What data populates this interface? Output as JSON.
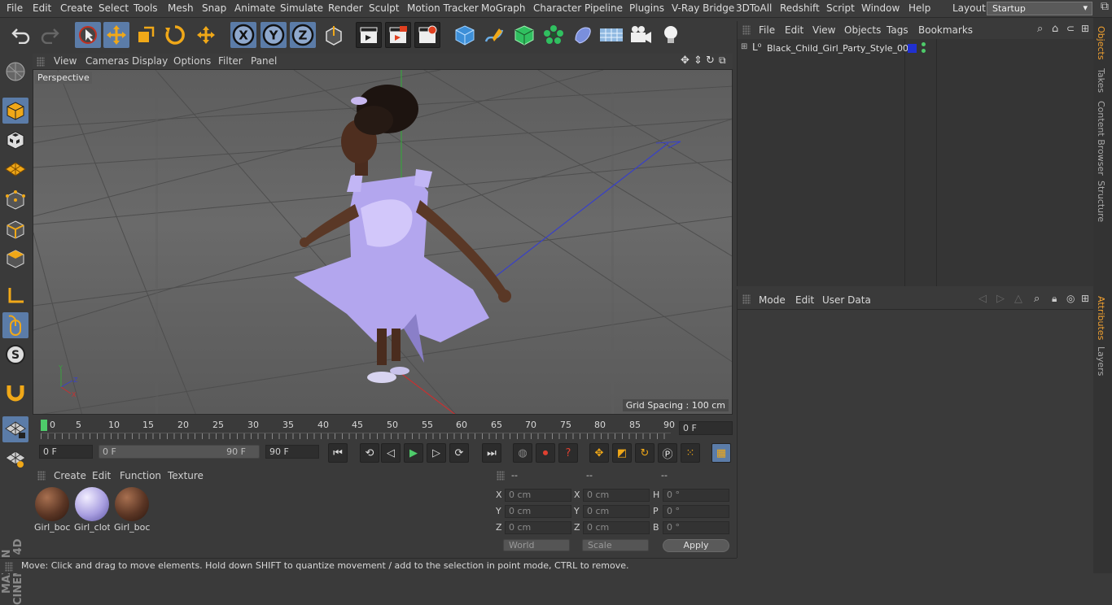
{
  "menubar": {
    "items": [
      "File",
      "Edit",
      "Create",
      "Select",
      "Tools",
      "Mesh",
      "Snap",
      "Animate",
      "Simulate",
      "Render",
      "Sculpt",
      "Motion Tracker",
      "MoGraph",
      "Character",
      "Pipeline",
      "Plugins",
      "V-Ray Bridge",
      "3DToAll",
      "Redshift",
      "Script",
      "Window",
      "Help"
    ],
    "layout_label": "Layout:",
    "layout_value": "Startup"
  },
  "viewport": {
    "menu": [
      "View",
      "Cameras",
      "Display",
      "Options",
      "Filter",
      "Panel"
    ],
    "camera": "Perspective",
    "grid_spacing": "Grid Spacing : 100 cm"
  },
  "timeline": {
    "ticks": [
      "0",
      "5",
      "10",
      "15",
      "20",
      "25",
      "30",
      "35",
      "40",
      "45",
      "50",
      "55",
      "60",
      "65",
      "70",
      "75",
      "80",
      "85",
      "90"
    ],
    "current_frame": "0 F"
  },
  "transport": {
    "start_frame": "0 F",
    "range_start": "0 F",
    "range_end": "90 F",
    "end_frame": "90 F"
  },
  "materials": {
    "menu": [
      "Create",
      "Edit",
      "Function",
      "Texture"
    ],
    "items": [
      {
        "label": "Girl_boc",
        "color": "#5a3524"
      },
      {
        "label": "Girl_clot",
        "color": "#a89ee0"
      },
      {
        "label": "Girl_boc",
        "color": "#5a3524"
      }
    ]
  },
  "coords": {
    "headers": [
      "--",
      "--",
      "--"
    ],
    "rows": [
      {
        "a": "X",
        "av": "0 cm",
        "b": "X",
        "bv": "0 cm",
        "c": "H",
        "cv": "0 °"
      },
      {
        "a": "Y",
        "av": "0 cm",
        "b": "Y",
        "bv": "0 cm",
        "c": "P",
        "cv": "0 °"
      },
      {
        "a": "Z",
        "av": "0 cm",
        "b": "Z",
        "bv": "0 cm",
        "c": "B",
        "cv": "0 °"
      }
    ],
    "world": "World",
    "scale": "Scale",
    "apply": "Apply"
  },
  "objects": {
    "menu": [
      "File",
      "Edit",
      "View",
      "Objects",
      "Tags",
      "Bookmarks"
    ],
    "item": "Black_Child_Girl_Party_Style_001"
  },
  "attributes": {
    "menu": [
      "Mode",
      "Edit",
      "User Data"
    ]
  },
  "sidetabs": [
    "Objects",
    "Takes",
    "Content Browser",
    "Structure",
    "Attributes",
    "Layers"
  ],
  "branding": "MAXON CINEMA 4D",
  "status": "Move: Click and drag to move elements. Hold down SHIFT to quantize movement / add to the selection in point mode, CTRL to remove."
}
